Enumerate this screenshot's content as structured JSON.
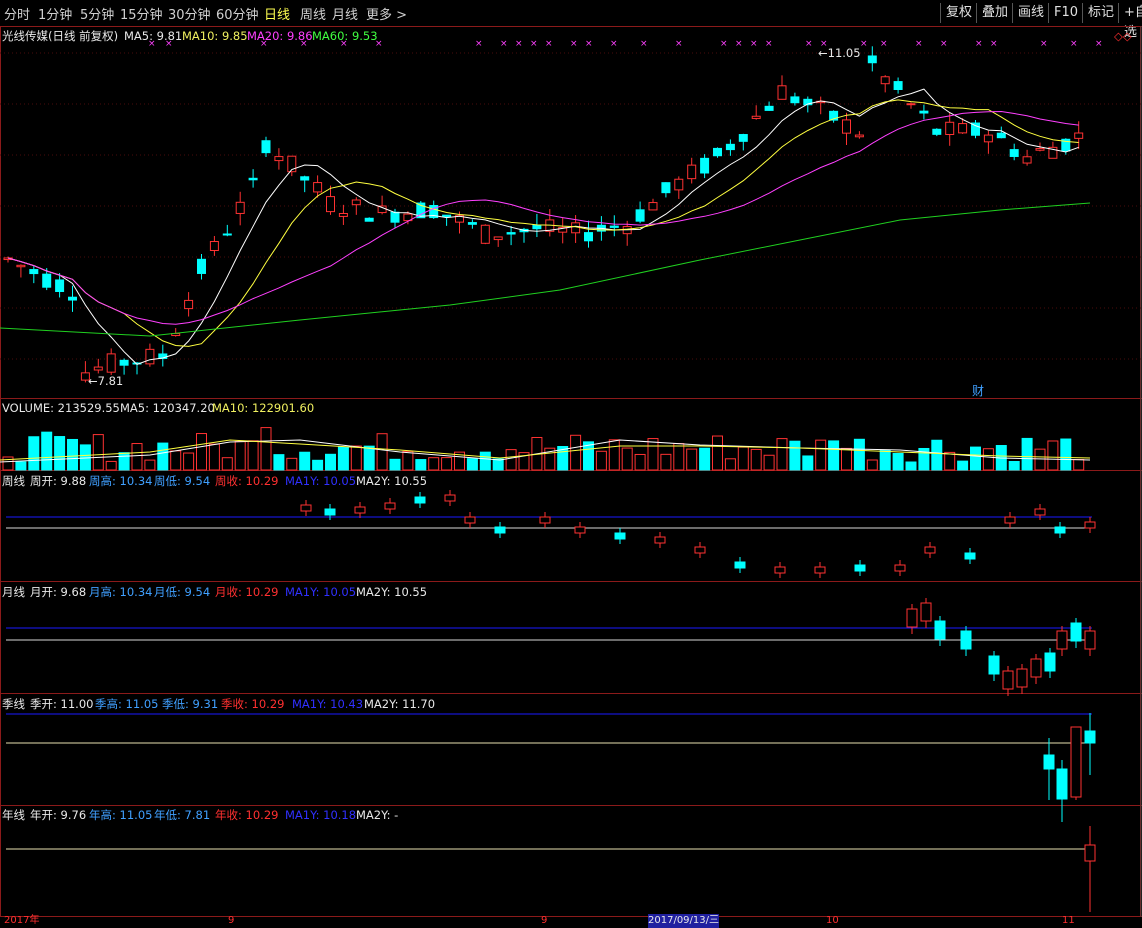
{
  "toolbar": {
    "periods": [
      "分时",
      "1分钟",
      "5分钟",
      "15分钟",
      "30分钟",
      "60分钟",
      "日线",
      "周线",
      "月线",
      "更多 >"
    ],
    "active_period": "日线",
    "right_buttons": [
      "复权",
      "叠加",
      "画线",
      "F10",
      "标记",
      "+自选"
    ]
  },
  "main_header": {
    "title": "光线传媒(日线 前复权)",
    "ma5": "MA5: 9.81",
    "ma10": "MA10: 9.85",
    "ma20": "MA20: 9.86",
    "ma60": "MA60: 9.53"
  },
  "main_annotations": {
    "high_label": "11.05",
    "low_label": "7.81",
    "news_marker": "财",
    "top_right_icon": "◇◇"
  },
  "volume_header": {
    "label": "VOLUME: 213529.55",
    "ma5": "MA5: 120347.20",
    "ma10": "MA10: 122901.60"
  },
  "weekly_header": {
    "name": "周线",
    "open": "周开: 9.88",
    "high": "周高: 10.34",
    "low": "周低: 9.54",
    "close": "周收: 10.29",
    "ma1y": "MA1Y: 10.05",
    "ma2y": "MA2Y: 10.55"
  },
  "monthly_header": {
    "name": "月线",
    "open": "月开: 9.68",
    "high": "月高: 10.34",
    "low": "月低: 9.54",
    "close": "月收: 10.29",
    "ma1y": "MA1Y: 10.05",
    "ma2y": "MA2Y: 10.55"
  },
  "quarterly_header": {
    "name": "季线",
    "open": "季开: 11.00",
    "high": "季高: 11.05",
    "low": "季低: 9.31",
    "close": "季收: 10.29",
    "ma1y": "MA1Y: 10.43",
    "ma2y": "MA2Y: 11.70"
  },
  "yearly_header": {
    "name": "年线",
    "open": "年开: 9.76",
    "high": "年高: 11.05",
    "low": "年低: 7.81",
    "close": "年收: 10.29",
    "ma1y": "MA1Y: 10.18",
    "ma2y": "MA2Y: -"
  },
  "time_axis": {
    "labels": [
      "2017年",
      "9",
      "9",
      "2017/09/13/三",
      "10",
      "11"
    ]
  },
  "colors": {
    "up": "#ff3232",
    "down": "#00ffff",
    "ma5": "#ffffff",
    "ma10": "#ffff40",
    "ma20": "#ff40ff",
    "ma60": "#20d020",
    "border": "#8b1a1a",
    "ma1y_line": "#1a1aff"
  }
}
